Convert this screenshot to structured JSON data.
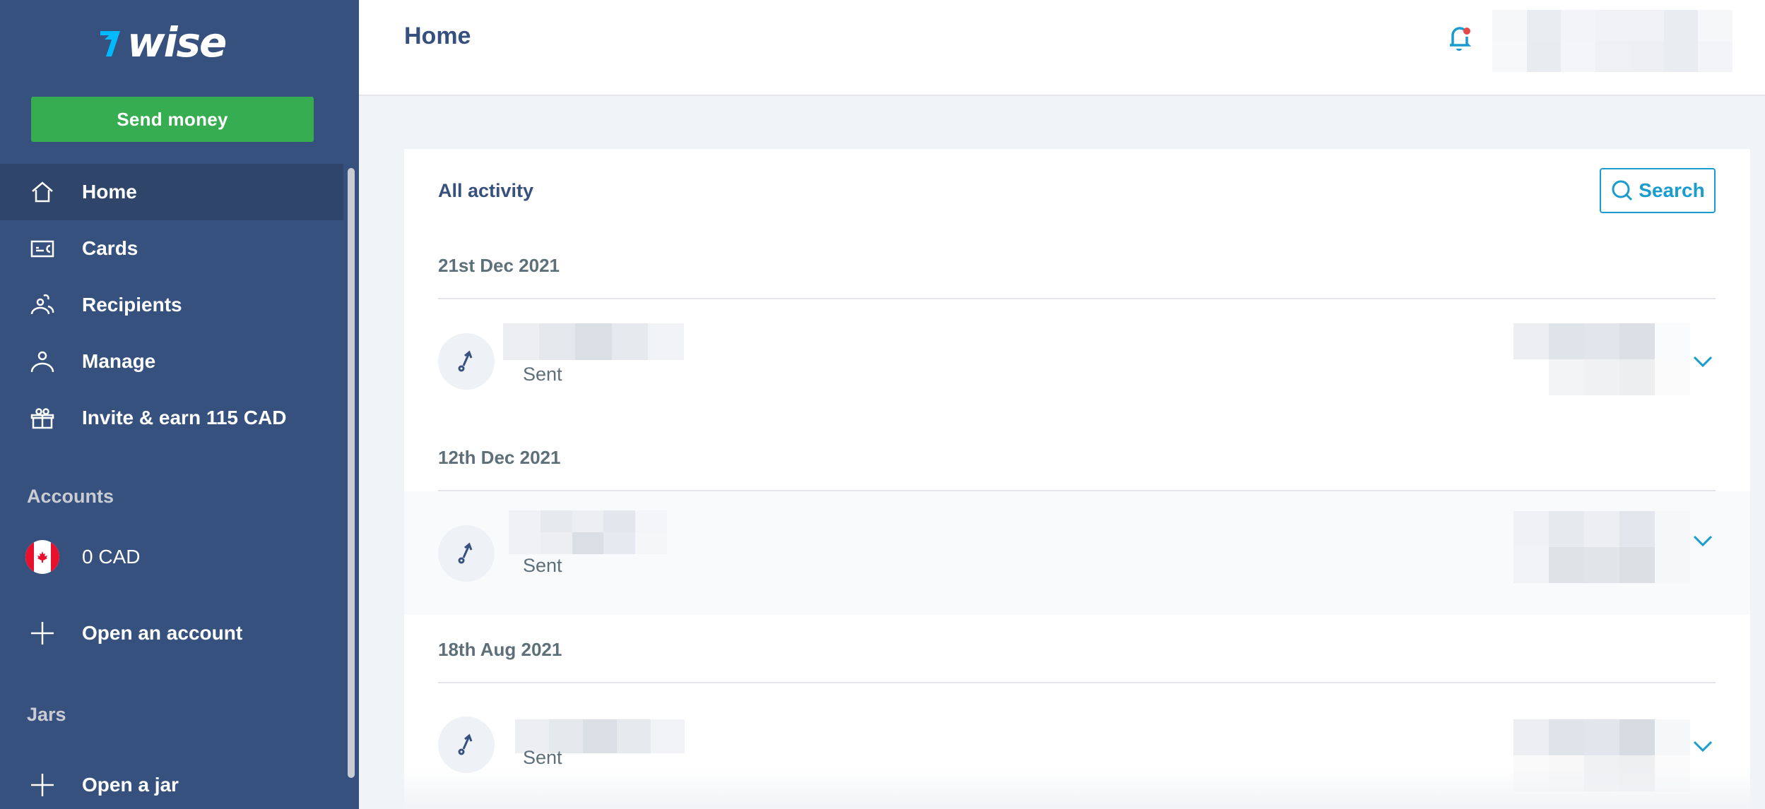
{
  "brand": {
    "name": "wise",
    "logo_icon": "wise-flag-icon",
    "accent": "#00b9ff"
  },
  "sidebar": {
    "send_money_label": "Send money",
    "nav": [
      {
        "label": "Home",
        "icon": "home-icon",
        "active": true
      },
      {
        "label": "Cards",
        "icon": "card-icon",
        "active": false
      },
      {
        "label": "Recipients",
        "icon": "recipients-icon",
        "active": false
      },
      {
        "label": "Manage",
        "icon": "person-icon",
        "active": false
      },
      {
        "label": "Invite & earn 115 CAD",
        "icon": "gift-icon",
        "active": false
      }
    ],
    "accounts_heading": "Accounts",
    "accounts": [
      {
        "balance": "0 CAD",
        "flag": "canada-flag-icon"
      }
    ],
    "open_account_label": "Open an account",
    "jars_heading": "Jars",
    "open_jar_label": "Open a jar"
  },
  "header": {
    "title": "Home",
    "notification_icon": "bell-icon",
    "has_unread": true
  },
  "activity": {
    "title": "All activity",
    "search_label": "Search",
    "groups": [
      {
        "date": "21st Dec 2021",
        "items": [
          {
            "status": "Sent",
            "icon": "sent-arrow-icon"
          }
        ]
      },
      {
        "date": "12th Dec 2021",
        "items": [
          {
            "status": "Sent",
            "icon": "sent-arrow-icon"
          }
        ]
      },
      {
        "date": "18th Aug 2021",
        "items": [
          {
            "status": "Sent",
            "icon": "sent-arrow-icon"
          }
        ]
      }
    ]
  },
  "colors": {
    "sidebar_bg": "#37517e",
    "sidebar_active": "#2f4569",
    "primary_button": "#37ad52",
    "link_accent": "#1a9ccf",
    "notification_dot": "#e74848",
    "content_bg": "#f1f4f7"
  }
}
